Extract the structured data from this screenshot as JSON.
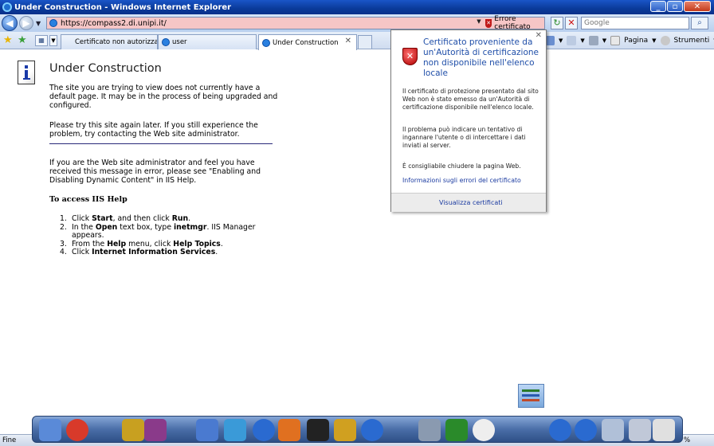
{
  "window": {
    "title": "Under Construction - Windows Internet Explorer"
  },
  "address_bar": {
    "url": "https://compass2.di.unipi.it/",
    "cert_error_label": "Errore certificato"
  },
  "search": {
    "placeholder": "Google"
  },
  "tabs": [
    {
      "label": "Certificato non autorizzato d..."
    },
    {
      "label": "user"
    },
    {
      "label": "Under Construction",
      "active": true
    }
  ],
  "command_bar": {
    "page_label": "Pagina",
    "tools_label": "Strumenti"
  },
  "page": {
    "title": "Under Construction",
    "para1": "The site you are trying to view does not currently have a default page. It may be in the process of being upgraded and configured.",
    "para2": "Please try this site again later. If you still experience the problem, try contacting the Web site administrator.",
    "para3": "If you are the Web site administrator and feel you have received this message in error, please see \"Enabling and Disabling Dynamic Content\" in IIS Help.",
    "help_heading": "To access IIS Help",
    "steps": [
      {
        "num": "1.",
        "parts": [
          {
            "t": "Click "
          },
          {
            "t": "Start",
            "b": true
          },
          {
            "t": ", and then click "
          },
          {
            "t": "Run",
            "b": true
          },
          {
            "t": "."
          }
        ]
      },
      {
        "num": "2.",
        "parts": [
          {
            "t": "In the "
          },
          {
            "t": "Open",
            "b": true
          },
          {
            "t": " text box, type "
          },
          {
            "t": "inetmgr",
            "b": true
          },
          {
            "t": ". IIS Manager appears."
          }
        ]
      },
      {
        "num": "3.",
        "parts": [
          {
            "t": "From the "
          },
          {
            "t": "Help",
            "b": true
          },
          {
            "t": " menu, click "
          },
          {
            "t": "Help Topics",
            "b": true
          },
          {
            "t": "."
          }
        ]
      },
      {
        "num": "4.",
        "parts": [
          {
            "t": "Click "
          },
          {
            "t": "Internet Information Services",
            "b": true
          },
          {
            "t": "."
          }
        ]
      }
    ]
  },
  "cert_popup": {
    "title": "Certificato proveniente da un'Autorità di certificazione non disponibile nell'elenco locale",
    "body1": "Il certificato di protezione presentato dal sito Web non è stato emesso da un'Autorità di certificazione disponibile nell'elenco locale.",
    "body2": "Il problema può indicare un tentativo di ingannare l'utente o di intercettare i dati inviati al server.",
    "body3": "È consigliabile chiudere la pagina Web.",
    "link": "Informazioni sugli errori del certificato",
    "footer_link": "Visualizza certificati"
  },
  "statusbar": {
    "text": "Fine",
    "zoom": "%"
  },
  "dock_icons": [
    "finder-icon",
    "power-icon",
    "library-icon",
    "media-icon",
    "apps-icon",
    "people-icon",
    "ie-icon",
    "firefox-icon",
    "linux-icon",
    "pencil-icon",
    "play-icon",
    "usb-icon",
    "trash-icon",
    "clock-icon",
    "ie2-icon",
    "play2-icon",
    "docs-icon",
    "drive-icon",
    "screen-icon"
  ],
  "colors": {
    "accent": "#1f4ea8",
    "cert_error": "#f6c6c6",
    "titlebar": "#0a3a9a"
  }
}
